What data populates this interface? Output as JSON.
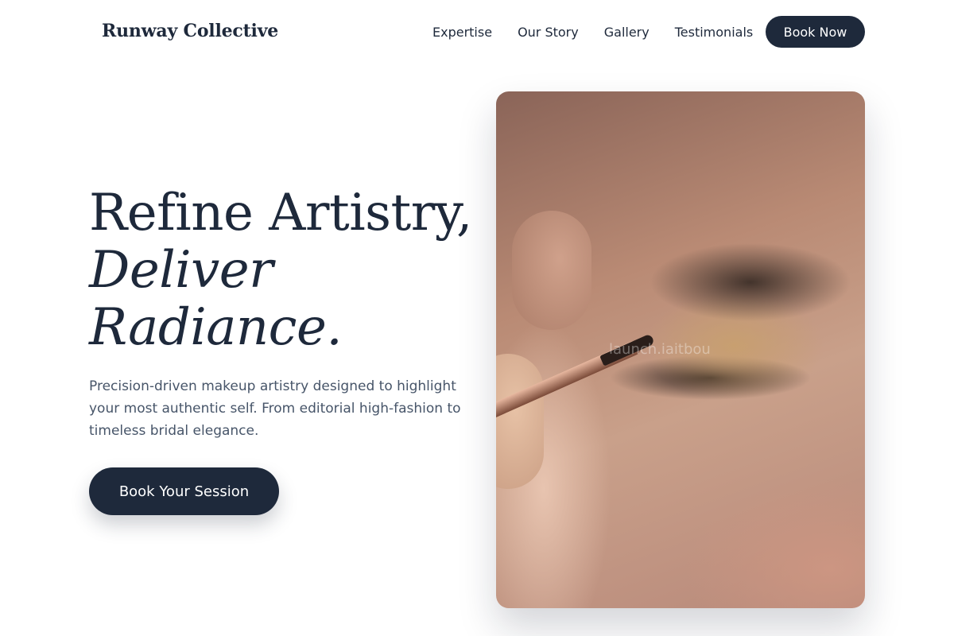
{
  "header": {
    "brand": "Runway Collective",
    "nav": [
      "Expertise",
      "Our Story",
      "Gallery",
      "Testimonials"
    ],
    "cta_label": "Book Now"
  },
  "hero": {
    "title_line1": "Refine Artistry,",
    "title_line2": "Deliver",
    "title_line3": "Radiance.",
    "subtitle": "Precision-driven makeup artistry designed to highlight your most authentic self. From editorial high-fashion to timeless bridal elegance.",
    "cta_label": "Book Your Session",
    "image": {
      "subject": "makeup-application-close-up",
      "watermark": "launch.iaitbou"
    }
  },
  "colors": {
    "primary": "#1e293b",
    "text_muted": "#475569",
    "background": "#ffffff"
  }
}
